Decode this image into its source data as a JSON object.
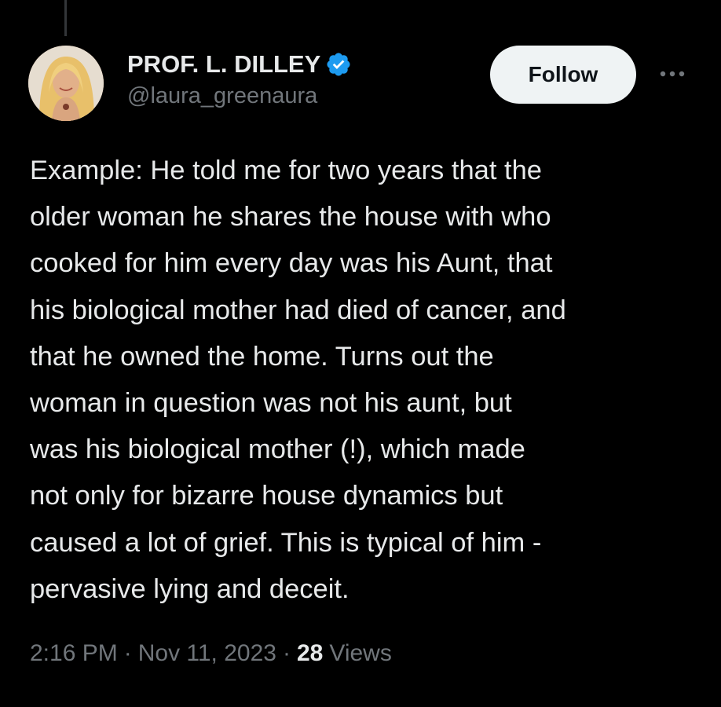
{
  "author": {
    "display_name": "PROF. L. DILLEY",
    "handle": "@laura_greenaura",
    "verified": true
  },
  "actions": {
    "follow_label": "Follow",
    "more_icon": "more-horizontal-icon"
  },
  "tweet": {
    "text": "Example: He told me for two years that the\nolder woman he shares the house with who\ncooked for him every day was his Aunt, that\nhis biological mother had died of cancer, and\nthat he owned the home. Turns out the\nwoman in question was not his aunt, but\nwas his biological mother (!), which made\nnot only for bizarre house dynamics but\ncaused a lot of grief. This is typical of him -\npervasive lying and deceit.",
    "time": "2:16 PM",
    "date": "Nov 11, 2023",
    "views_count": "28",
    "views_label": "Views",
    "separator": "·"
  },
  "colors": {
    "background": "#000000",
    "text_primary": "#e7e9ea",
    "text_secondary": "#71767b",
    "follow_bg": "#eff3f4",
    "verified_blue": "#1d9bf0"
  }
}
